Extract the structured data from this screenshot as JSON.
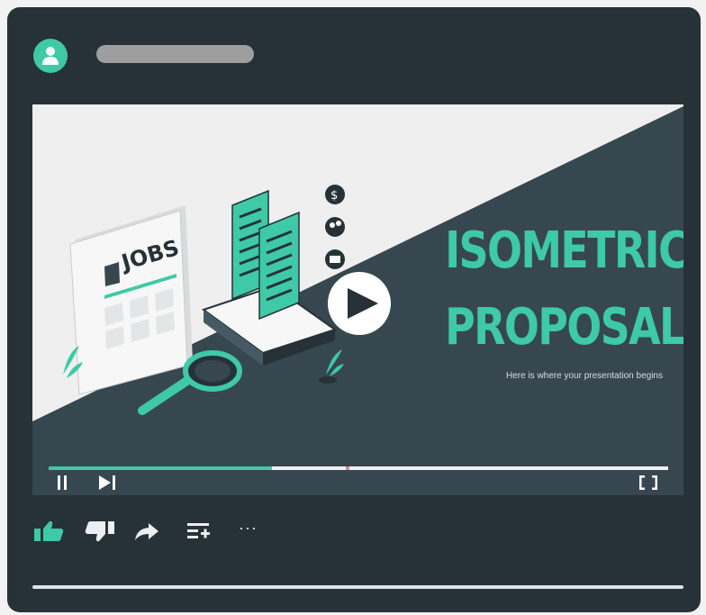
{
  "post": {
    "avatar_icon": "user-icon",
    "author_placeholder": ""
  },
  "video": {
    "title_line1": "ISOMETRIC",
    "title_line2": "PROPOSAL",
    "subtitle": "Here is where your presentation begins",
    "newspaper_label": "JOBS",
    "progress": 0.36,
    "buffered_marker": 0.48,
    "controls": {
      "pause_icon": "pause-icon",
      "next_icon": "skip-next-icon",
      "fullscreen_icon": "fullscreen-icon",
      "play_icon": "play-icon"
    }
  },
  "actions": {
    "like": "thumbs-up-icon",
    "dislike": "thumbs-down-icon",
    "share": "share-icon",
    "add_to_playlist": "playlist-add-icon",
    "more": "···"
  },
  "colors": {
    "accent": "#3ec9a7",
    "card": "#263238",
    "video_light": "#efefef",
    "video_dark": "#37474f"
  }
}
